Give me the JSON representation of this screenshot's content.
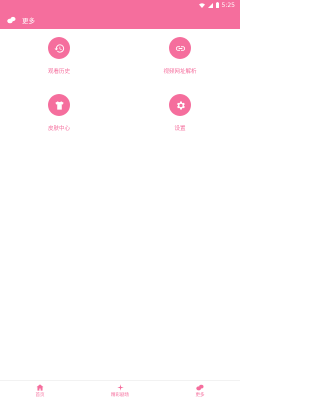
{
  "status_bar": {
    "time": "5:25"
  },
  "app_bar": {
    "title": "更多"
  },
  "menu": {
    "items": [
      {
        "label": "观看历史",
        "icon": "history-icon"
      },
      {
        "label": "视频网址解析",
        "icon": "link-icon"
      },
      {
        "label": "皮肤中心",
        "icon": "tshirt-icon"
      },
      {
        "label": "设置",
        "icon": "gear-icon"
      }
    ]
  },
  "bottom_nav": {
    "items": [
      {
        "label": "首页",
        "icon": "home-icon"
      },
      {
        "label": "精彩剧场",
        "icon": "sparkle-icon"
      },
      {
        "label": "更多",
        "icon": "bean-icon"
      }
    ]
  },
  "colors": {
    "accent": "#f56e9d",
    "background": "#ffffff"
  }
}
